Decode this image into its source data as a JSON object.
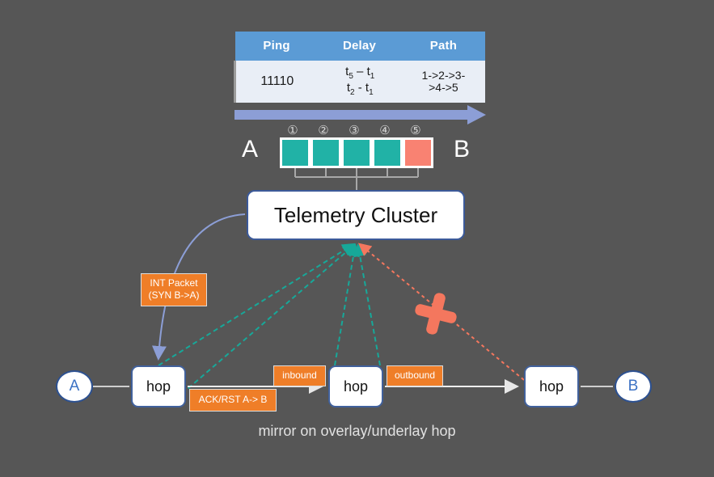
{
  "diagram": {
    "background_color": "#565656",
    "caption": "mirror on overlay/underlay hop"
  },
  "table": {
    "name": "ping-delay-path-table",
    "header_color": "#5b9bd5",
    "row_color": "#e9eef6",
    "columns": [
      "Ping",
      "Delay",
      "Path"
    ],
    "rows": [
      {
        "ping": "11110",
        "delay_line1_pre": "t",
        "delay_line1_sub": "5",
        "delay_line1_post": " – t",
        "delay_line1_sub2": "1",
        "delay_line2_pre": "t",
        "delay_line2_sub": "2",
        "delay_line2_post": " - t",
        "delay_line2_sub2": "1",
        "path_line1": "1->2->3-",
        "path_line2": ">4->5"
      }
    ]
  },
  "flow": {
    "arrow_color": "#8c9ed6",
    "endpoint_left_label": "A",
    "endpoint_right_label": "B",
    "hop_markers": [
      {
        "number": "①",
        "state": "ok",
        "color": "#21b2a6"
      },
      {
        "number": "②",
        "state": "ok",
        "color": "#21b2a6"
      },
      {
        "number": "③",
        "state": "ok",
        "color": "#21b2a6"
      },
      {
        "number": "④",
        "state": "ok",
        "color": "#21b2a6"
      },
      {
        "number": "⑤",
        "state": "fail",
        "color": "#f98272"
      }
    ]
  },
  "telemetry": {
    "label": "Telemetry Cluster",
    "border_color": "#3c5a9a"
  },
  "labels": {
    "int_packet_line1": "INT Packet",
    "int_packet_line2": "(SYN B->A)",
    "ack_rst": "ACK/RST A-> B",
    "inbound": "inbound",
    "outbound": "outbound",
    "orange_color": "#ef7e28"
  },
  "network": {
    "endpoint_a": "A",
    "endpoint_b": "B",
    "hops": [
      {
        "label": "hop"
      },
      {
        "label": "hop"
      },
      {
        "label": "hop"
      }
    ],
    "hop_border_color": "#41619c",
    "mirror_line_color": "#17a899",
    "failed_line_color": "#f4775e"
  }
}
